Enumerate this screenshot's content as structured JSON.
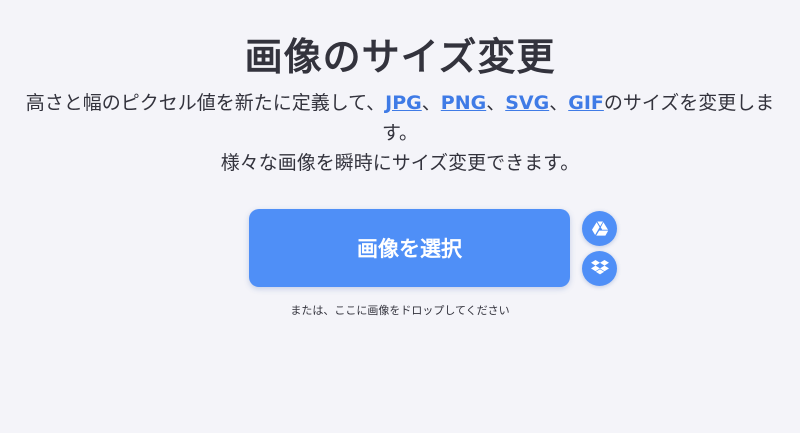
{
  "header": {
    "title": "画像のサイズ変更"
  },
  "description": {
    "part1": "高さと幅のピクセル値を新たに定義して、",
    "formats": [
      "JPG",
      "PNG",
      "SVG",
      "GIF"
    ],
    "separator": "、",
    "part2": "のサイズを変更します。",
    "line2": "様々な画像を瞬時にサイズ変更できます。"
  },
  "upload": {
    "select_label": "画像を選択",
    "drop_hint": "または、ここに画像をドロップしてください",
    "cloud_icons": [
      "google-drive-icon",
      "dropbox-icon"
    ]
  },
  "colors": {
    "accent": "#4f8ff7",
    "link": "#3f7be6",
    "text": "#33333d",
    "background": "#f4f4f9"
  }
}
